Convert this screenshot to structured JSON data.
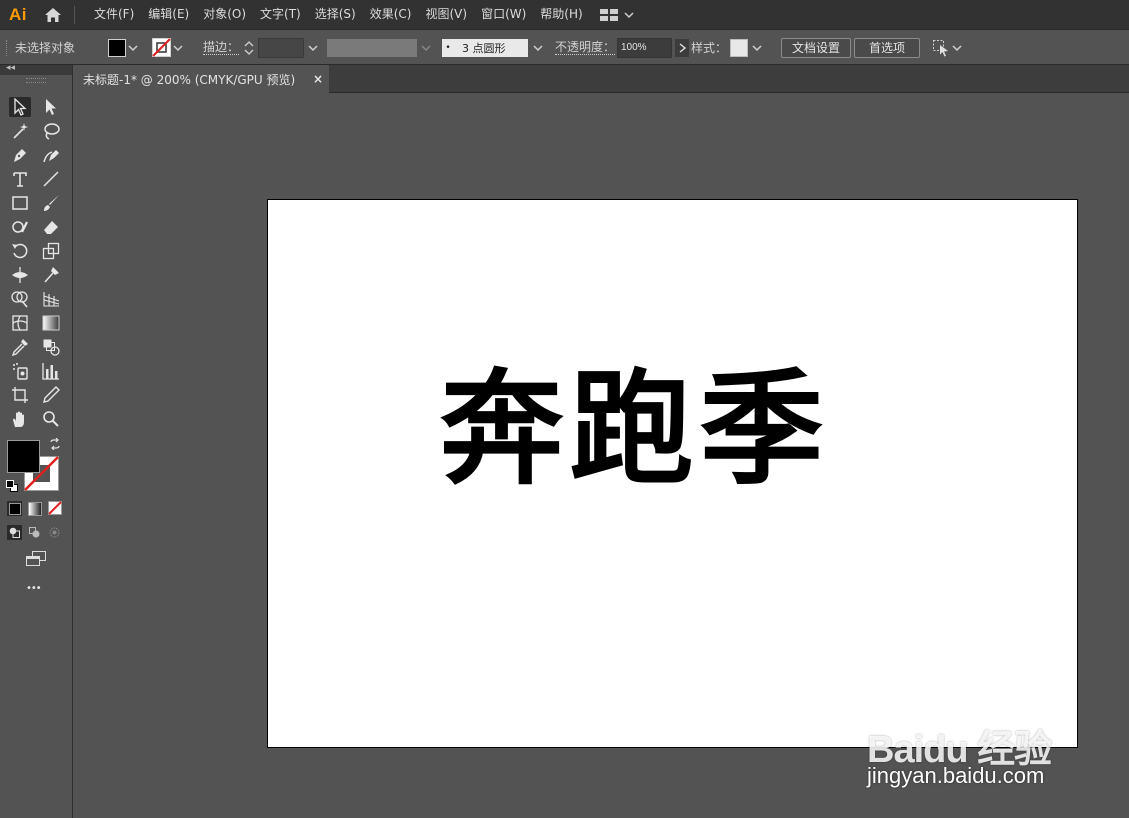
{
  "app": {
    "logo_text": "Ai"
  },
  "menu": {
    "items": [
      {
        "label": "文件(F)"
      },
      {
        "label": "编辑(E)"
      },
      {
        "label": "对象(O)"
      },
      {
        "label": "文字(T)"
      },
      {
        "label": "选择(S)"
      },
      {
        "label": "效果(C)"
      },
      {
        "label": "视图(V)"
      },
      {
        "label": "窗口(W)"
      },
      {
        "label": "帮助(H)"
      }
    ]
  },
  "control_bar": {
    "selection_status": "未选择对象",
    "fill_color": "#000000",
    "stroke_label": "描边：",
    "brush_label": "3 点圆形",
    "opacity_label": "不透明度：",
    "opacity_value": "100%",
    "style_label": "样式：",
    "doc_setup_button": "文档设置",
    "preferences_button": "首选项"
  },
  "document": {
    "tab_title": "未标题-1* @ 200% (CMYK/GPU 预览)",
    "close_glyph": "×",
    "artwork_text": "奔跑季"
  },
  "tools": {
    "fill_color": "#000000",
    "stroke_color": "none",
    "more_glyph": "•••"
  },
  "watermark": {
    "brand": "Baidu 经验",
    "url": "jingyan.baidu.com"
  }
}
